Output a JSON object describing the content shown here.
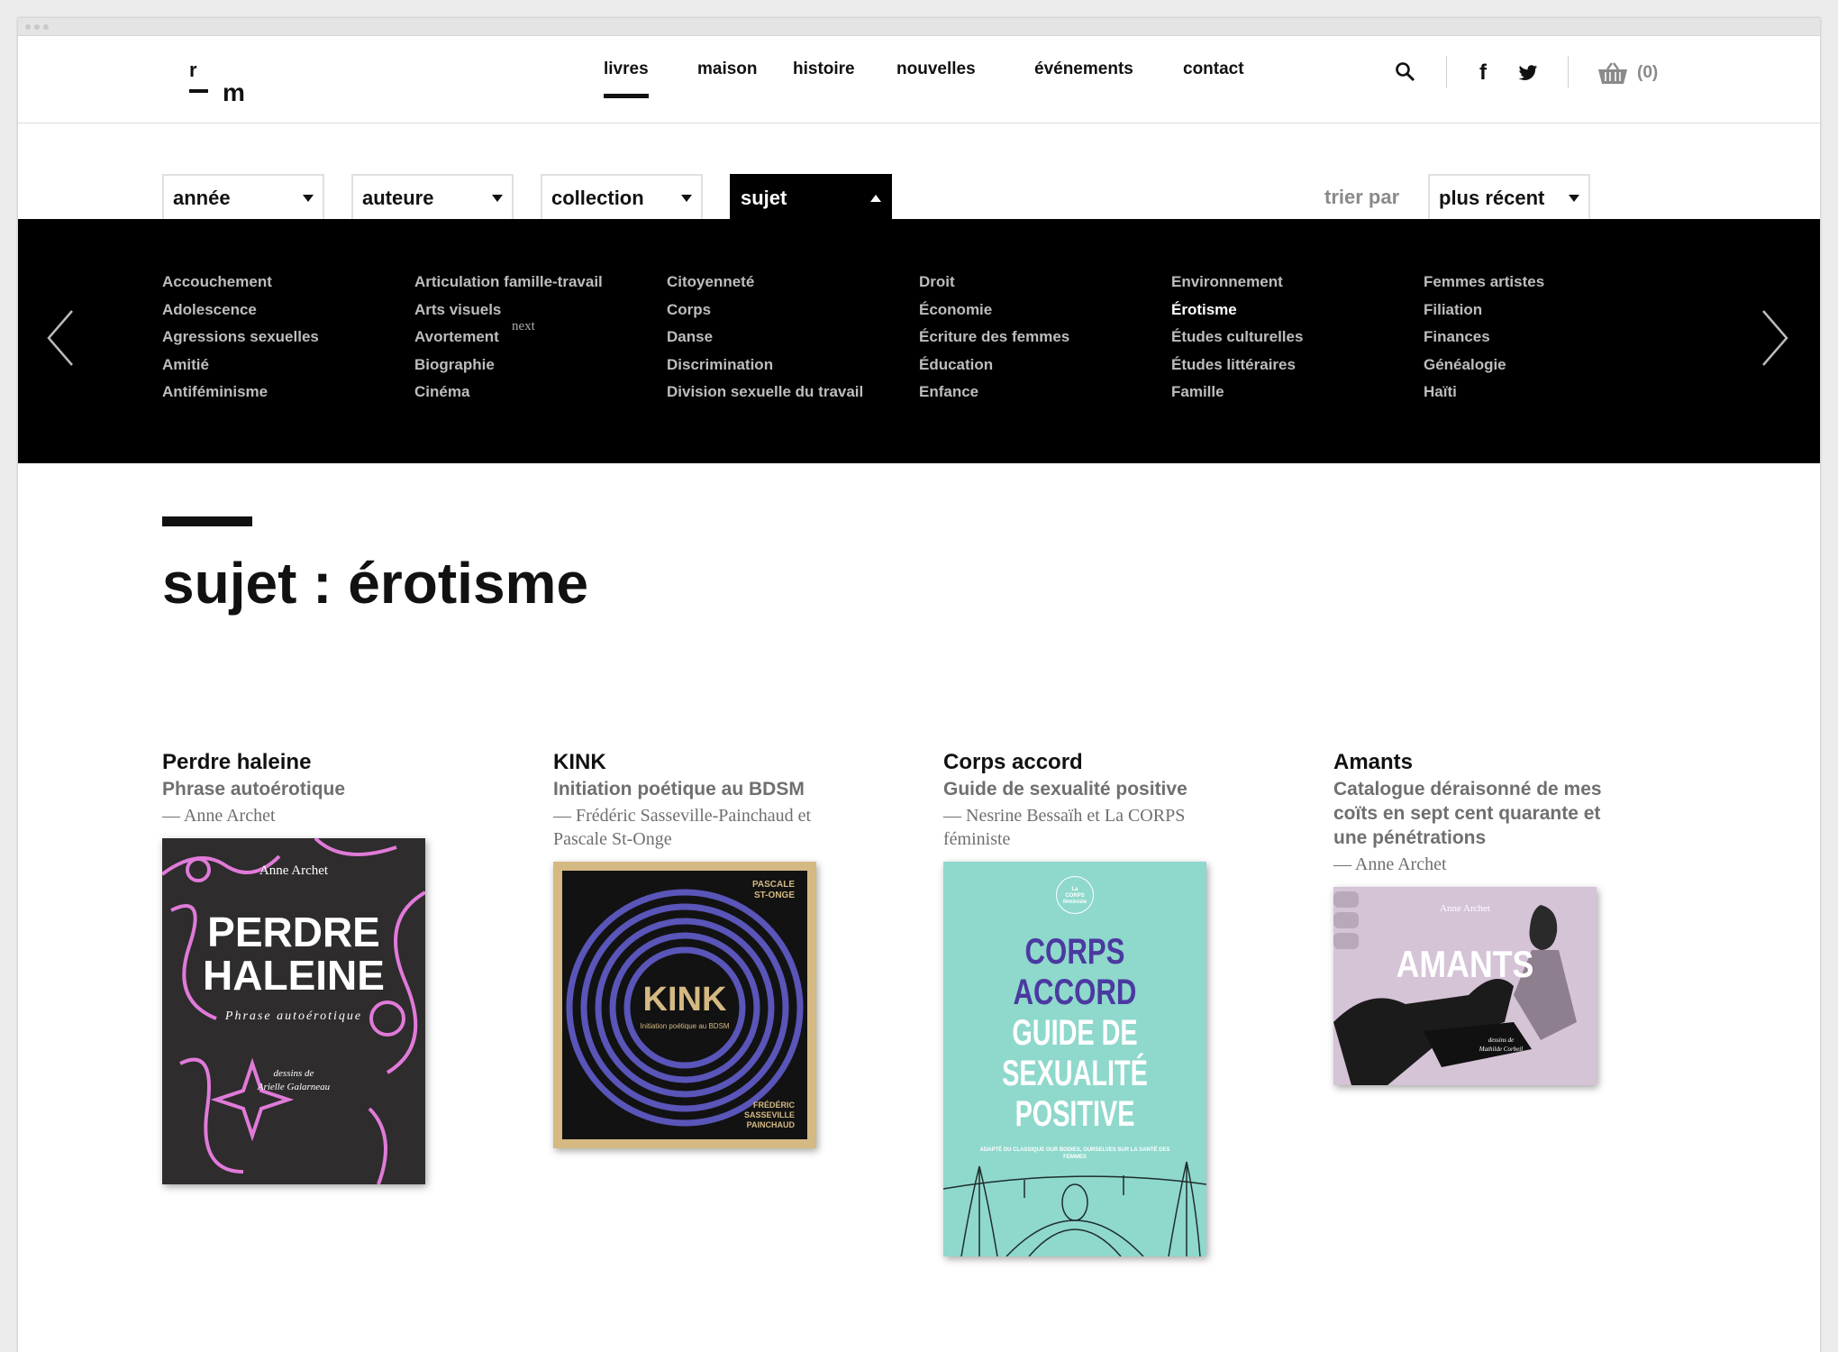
{
  "logo": {
    "r": "r",
    "m": "m"
  },
  "nav": [
    {
      "label": "livres",
      "active": true
    },
    {
      "label": "maison"
    },
    {
      "label": "histoire"
    },
    {
      "label": "nouvelles"
    },
    {
      "label": "événements"
    },
    {
      "label": "contact"
    }
  ],
  "header": {
    "search_icon": "search-icon",
    "facebook": "f",
    "twitter_icon": "twitter-icon",
    "cart_icon": "basket-icon",
    "cart_count": "(0)"
  },
  "filters": [
    {
      "label": "année"
    },
    {
      "label": "auteure"
    },
    {
      "label": "collection"
    },
    {
      "label": "sujet",
      "open": true
    }
  ],
  "sort": {
    "label": "trier par",
    "value": "plus récent"
  },
  "subjects": {
    "columns": [
      [
        "Accouchement",
        "Adolescence",
        "Agressions sexuelles",
        "Amitié",
        "Antiféminisme"
      ],
      [
        "Articulation famille-travail",
        "Arts visuels",
        "Avortement",
        "Biographie",
        "Cinéma"
      ],
      [
        "Citoyenneté",
        "Corps",
        "Danse",
        "Discrimination",
        "Division sexuelle du travail"
      ],
      [
        "Droit",
        "Économie",
        "Écriture des femmes",
        "Éducation",
        "Enfance"
      ],
      [
        "Environnement",
        "Érotisme",
        "Études culturelles",
        "Études littéraires",
        "Famille"
      ],
      [
        "Femmes artistes",
        "Filiation",
        "Finances",
        "Généalogie",
        "Haïti"
      ]
    ],
    "active": "Érotisme",
    "next_hint": "next"
  },
  "page_title": "sujet : érotisme",
  "books": [
    {
      "title": "Perdre haleine",
      "subtitle": "Phrase autoérotique",
      "author": "— Anne Archet",
      "cover": {
        "author": "Anne Archet",
        "line1": "PERDRE",
        "line2": "HALEINE",
        "sub": "Phrase autoérotique",
        "credit1": "dessins de",
        "credit2": "Arielle Galarneau",
        "bg": "#2e2c2c",
        "accent": "#e07ad9"
      }
    },
    {
      "title": "KINK",
      "subtitle": "Initiation poétique au BDSM",
      "author": "— Frédéric Sasseville-Painchaud et Pascale St-Onge",
      "cover": {
        "top_author1": "PASCALE",
        "top_author2": "ST-ONGE",
        "word": "KINK",
        "sub": "Initiation poétique au BDSM",
        "bottom1": "FRÉDÉRIC",
        "bottom2": "SASSEVILLE",
        "bottom3": "PAINCHAUD",
        "bg": "#121212",
        "frame": "#d4b982",
        "rings": "#5a55b8"
      }
    },
    {
      "title": "Corps accord",
      "subtitle": "Guide de sexualité positive",
      "author": "— Nesrine Bessaïh et La CORPS féministe",
      "cover": {
        "badge1": "La",
        "badge2": "CORPS",
        "badge3": "féministe",
        "lines": [
          "CORPS",
          "ACCORD",
          "GUIDE DE",
          "SEXUALITÉ",
          "POSITIVE"
        ],
        "tagline": "ADAPTÉ DU CLASSIQUE OUR BODIES, OURSELVES SUR LA SANTÉ DES FEMMES",
        "bg": "#8fd8cc",
        "ink1": "#4a3aa0",
        "ink2": "#ffffff"
      }
    },
    {
      "title": "Amants",
      "subtitle": "Catalogue déraisonné de mes coïts en sept cent quarante et une pénétrations",
      "author": "— Anne Archet",
      "cover": {
        "author": "Anne Archet",
        "word": "AMANTS",
        "credit1": "dessins de",
        "credit2": "Mathilde Corbeil",
        "bg": "#d5c3d6"
      }
    }
  ]
}
